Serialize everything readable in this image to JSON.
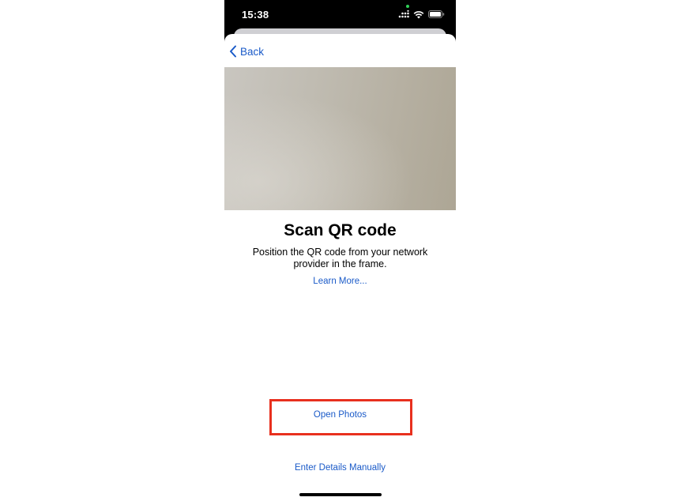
{
  "status_bar": {
    "time": "15:38",
    "icons": [
      "signal-icon",
      "wifi-icon",
      "battery-icon"
    ]
  },
  "nav": {
    "back_label": "Back",
    "back_icon": "chevron-left-icon"
  },
  "camera": {
    "icon": "camera-viewfinder"
  },
  "content": {
    "title": "Scan QR code",
    "instructions": "Position the QR code from your network provider in the frame.",
    "learn_more": "Learn More..."
  },
  "actions": {
    "open_photos": "Open Photos",
    "enter_details_manually": "Enter Details Manually"
  },
  "colors": {
    "link": "#1a5ac8",
    "highlight": "#e8301e"
  }
}
